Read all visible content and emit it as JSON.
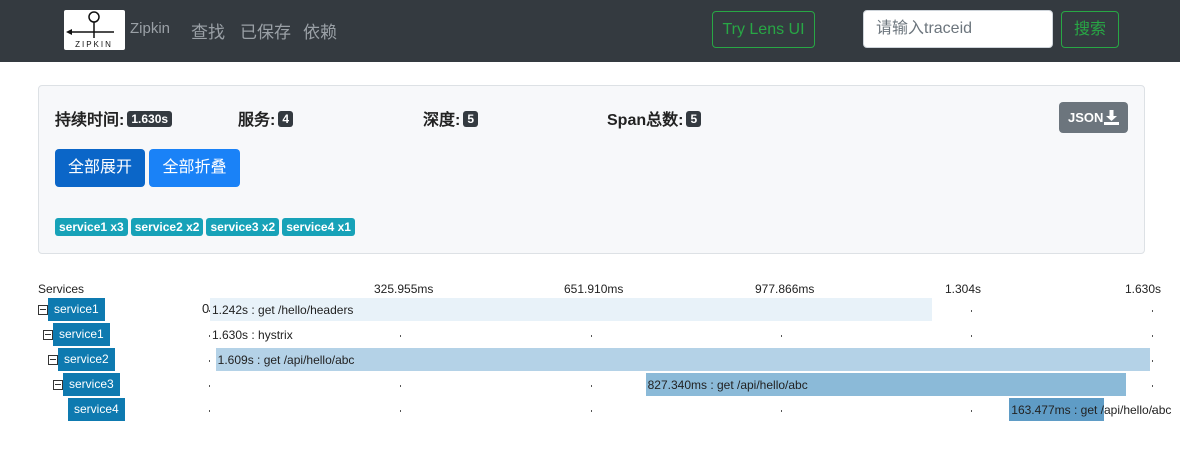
{
  "navbar": {
    "brand": "Zipkin",
    "logo_text": "ZIPKIN",
    "links": [
      "查找",
      "已保存",
      "依赖"
    ],
    "lens_button": "Try Lens UI",
    "search_placeholder": "请输入traceid",
    "search_button": "搜索"
  },
  "summary": {
    "duration_label": "持续时间:",
    "duration_value": "1.630s",
    "services_label": "服务:",
    "services_value": "4",
    "depth_label": "深度:",
    "depth_value": "5",
    "span_count_label": "Span总数:",
    "span_count_value": "5",
    "json_button": "JSON",
    "expand_all": "全部展开",
    "collapse_all": "全部折叠",
    "service_badges": [
      "service1 x3",
      "service2 x2",
      "service3 x2",
      "service4 x1"
    ]
  },
  "trace": {
    "services_header": "Services",
    "ticks": [
      "325.955ms",
      "651.910ms",
      "977.866ms",
      "1.304s",
      "1.630s"
    ],
    "zero_marker": "0",
    "spans": [
      {
        "service": "service1",
        "text": "1.242s : get /hello/headers",
        "start_fraction": 0.0,
        "duration_fraction": 0.762,
        "color": "#e8f2f9",
        "has_toggle": true,
        "depth": 0
      },
      {
        "service": "service1",
        "text": "1.630s : hystrix",
        "start_fraction": 0.0,
        "duration_fraction": 0.004,
        "color": "#ffffff",
        "has_toggle": true,
        "depth": 1
      },
      {
        "service": "service2",
        "text": "1.609s : get /api/hello/abc",
        "start_fraction": 0.006,
        "duration_fraction": 0.987,
        "color": "#b4d2e7",
        "has_toggle": true,
        "depth": 2
      },
      {
        "service": "service3",
        "text": "827.340ms : get /api/hello/abc",
        "start_fraction": 0.46,
        "duration_fraction": 0.507,
        "color": "#8bbad8",
        "has_toggle": true,
        "depth": 3
      },
      {
        "service": "service4",
        "text": "163.477ms : get /api/hello/abc",
        "start_fraction": 0.844,
        "duration_fraction": 0.1,
        "color": "#5f9cc6",
        "has_toggle": false,
        "depth": 4
      }
    ]
  }
}
